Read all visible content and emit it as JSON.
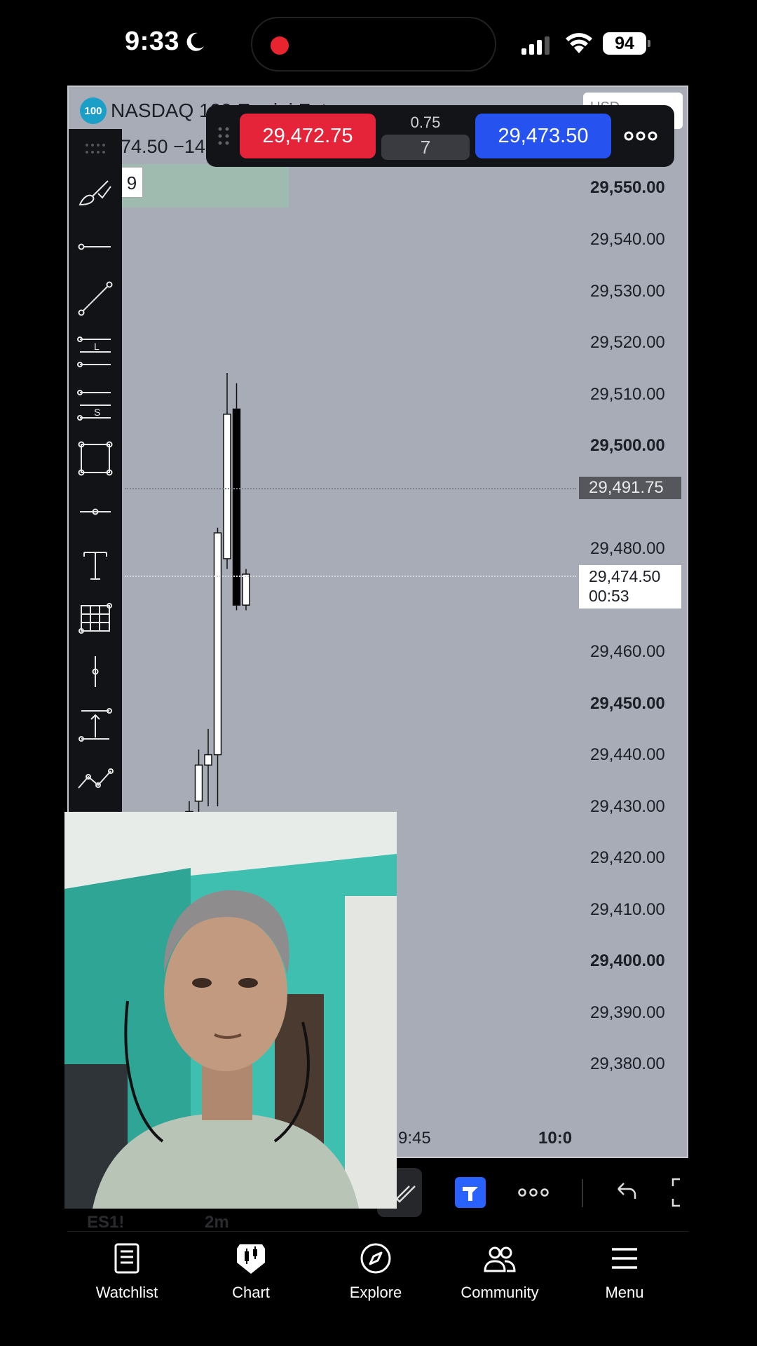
{
  "status_bar": {
    "time": "9:33",
    "battery": "94"
  },
  "chart": {
    "symbol_badge": "100",
    "symbol_name": "NASDAQ 100 E-mini Futures",
    "currency": "USD",
    "ohlc_fragment": "74.50  −14",
    "highlight_badge": "9",
    "price_axis": [
      {
        "value": "29,550.00",
        "bold": true
      },
      {
        "value": "29,540.00",
        "bold": false
      },
      {
        "value": "29,530.00",
        "bold": false
      },
      {
        "value": "29,520.00",
        "bold": false
      },
      {
        "value": "29,510.00",
        "bold": false
      },
      {
        "value": "29,500.00",
        "bold": true
      },
      {
        "value": "29,480.00",
        "bold": false
      },
      {
        "value": "29,460.00",
        "bold": false
      },
      {
        "value": "29,450.00",
        "bold": true
      },
      {
        "value": "29,440.00",
        "bold": false
      },
      {
        "value": "29,430.00",
        "bold": false
      },
      {
        "value": "29,420.00",
        "bold": false
      },
      {
        "value": "29,410.00",
        "bold": false
      },
      {
        "value": "29,400.00",
        "bold": true
      },
      {
        "value": "29,390.00",
        "bold": false
      },
      {
        "value": "29,380.00",
        "bold": false
      }
    ],
    "crosshair_price": "29,491.75",
    "last_price": "29,474.50",
    "countdown": "00:53",
    "time_labels": [
      {
        "text": "9:45",
        "bold": false
      },
      {
        "text": "10:0",
        "bold": true
      }
    ],
    "candles": [
      {
        "o": 29428,
        "h": 29431,
        "l": 29425,
        "c": 29429,
        "up": true
      },
      {
        "o": 29431,
        "h": 29441,
        "l": 29428,
        "c": 29438,
        "up": true
      },
      {
        "o": 29438,
        "h": 29445,
        "l": 29430,
        "c": 29440,
        "up": true
      },
      {
        "o": 29440,
        "h": 29484,
        "l": 29430,
        "c": 29483,
        "up": true
      },
      {
        "o": 29478,
        "h": 29514,
        "l": 29476,
        "c": 29506,
        "up": true
      },
      {
        "o": 29507,
        "h": 29512,
        "l": 29468,
        "c": 29469,
        "up": false
      },
      {
        "o": 29469,
        "h": 29476,
        "l": 29468,
        "c": 29475,
        "up": true
      }
    ]
  },
  "quote_panel": {
    "sell_price": "29,472.75",
    "spread": "0.75",
    "quantity": "7",
    "buy_price": "29,473.50"
  },
  "tool_strip": {
    "ghost_symbol": "ES1!",
    "ghost_interval": "2m"
  },
  "nav": [
    {
      "label": "Watchlist",
      "icon": "watchlist-icon"
    },
    {
      "label": "Chart",
      "icon": "chart-icon"
    },
    {
      "label": "Explore",
      "icon": "compass-icon"
    },
    {
      "label": "Community",
      "icon": "community-icon"
    },
    {
      "label": "Menu",
      "icon": "menu-icon"
    }
  ]
}
